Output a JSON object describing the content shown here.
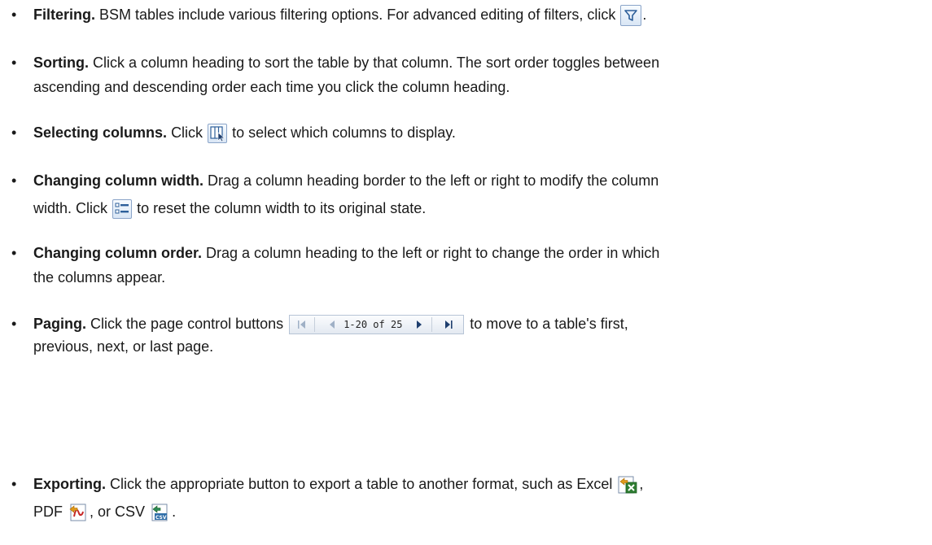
{
  "items": [
    {
      "lead": "Filtering.",
      "text1": "BSM tables include various filtering options. For advanced editing of filters, click",
      "text2": "."
    },
    {
      "lead": "Sorting.",
      "line1": "Click a column heading to sort the table by that column. The sort order toggles between",
      "line2": "ascending and descending order each time you click the column heading."
    },
    {
      "lead": "Selecting columns.",
      "text1": "Click",
      "text2": "to select which columns to display."
    },
    {
      "lead": "Changing column width.",
      "line1": "Drag a column heading border to the left or right to modify the column",
      "text1": "width. Click",
      "text2": "to reset the column width to its original state."
    },
    {
      "lead": "Changing column order.",
      "line1": "Drag a column heading to the left or right to change the order in which",
      "line2": "the columns appear."
    },
    {
      "lead": "Paging.",
      "text1": "Click the page control buttons",
      "pager_text": "1-20 of 25",
      "text2": "to move to a table's first,",
      "line2": "previous, next, or last page."
    },
    {
      "lead": "Exporting.",
      "line1": "Click the appropriate button to export a table to another format, such as Excel",
      "line1_end": ",",
      "text_pdf": "PDF",
      "text_or": ", or CSV",
      "text_end": "."
    }
  ],
  "icons": {
    "filter": "filter-icon",
    "select_columns": "select-columns-icon",
    "reset_width": "reset-column-width-icon",
    "excel": "export-excel-icon",
    "pdf": "export-pdf-icon",
    "csv": "export-csv-icon"
  }
}
